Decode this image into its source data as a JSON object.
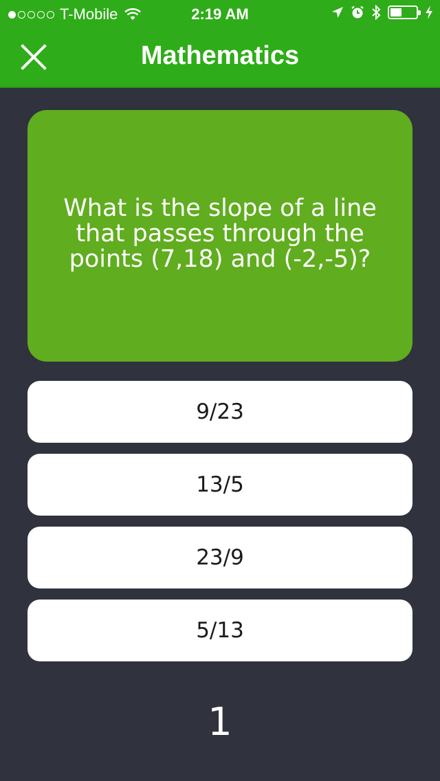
{
  "status_bar": {
    "carrier": "T-Mobile",
    "time": "2:19 AM",
    "signal_filled": 1,
    "signal_total": 5,
    "battery_level_fraction": 0.45
  },
  "header": {
    "title": "Mathematics",
    "close_icon": "close-icon",
    "background_color": "#2fac19"
  },
  "question": {
    "text": "What is the slope of a line that passes through the points (7,18) and (-2,-5)?",
    "card_color": "#60ad1f"
  },
  "answers": [
    {
      "label": "9/23"
    },
    {
      "label": "13/5"
    },
    {
      "label": "23/9"
    },
    {
      "label": "5/13"
    }
  ],
  "counter": "1",
  "colors": {
    "background": "#30323e",
    "answer_background": "#ffffff"
  }
}
